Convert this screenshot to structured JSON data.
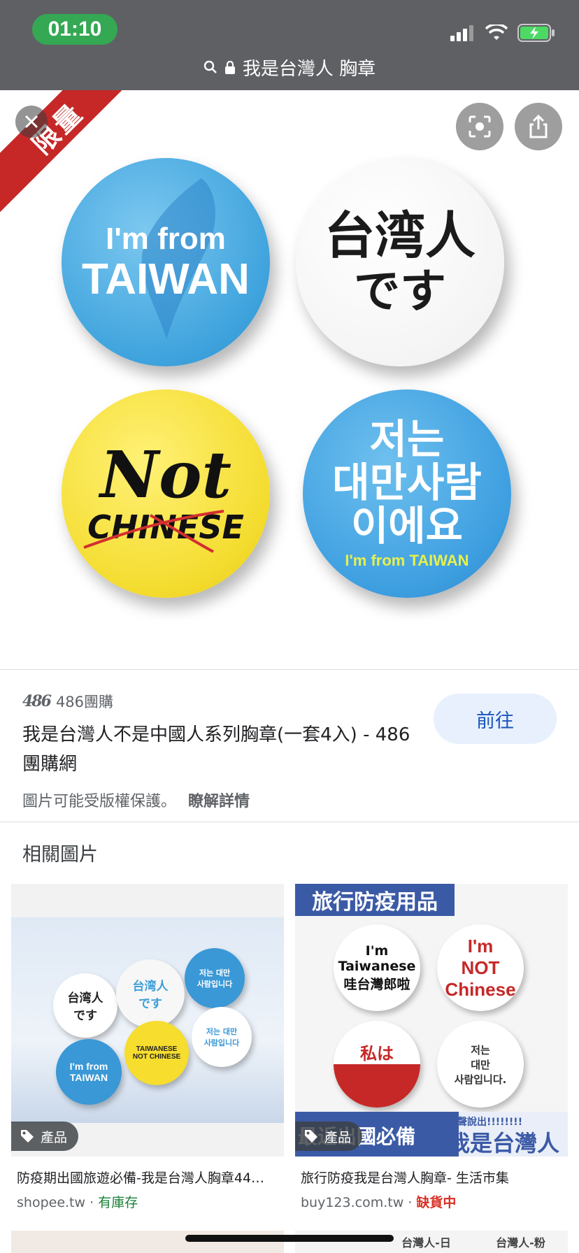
{
  "status": {
    "time": "01:10"
  },
  "urlbar": {
    "query": "我是台灣人 胸章"
  },
  "hero": {
    "ribbon": "限量",
    "badges": [
      {
        "line1": "I'm from",
        "line2": "TAIWAN"
      },
      {
        "line1": "台湾人",
        "line2": "です"
      },
      {
        "line1": "Not",
        "line2": "CHINESE"
      },
      {
        "line1": "저는\n대만사람\n이에요",
        "line2": "I'm from TAIWAN"
      }
    ]
  },
  "result": {
    "source_logo": "486",
    "source_name": "486團購",
    "title": "我是台灣人不是中國人系列胸章(一套4入) - 486團購網",
    "goto_label": "前往",
    "copyright_text": "圖片可能受版權保護。",
    "learn_more": "瞭解詳情"
  },
  "related": {
    "title": "相關圖片",
    "cards": [
      {
        "chip": "產品",
        "caption": "防疫期出國旅遊必備-我是台灣人胸章44…",
        "site": "shopee.tw",
        "stock": "有庫存",
        "stock_color": "#188038",
        "mini_badges": [
          "台湾人\nです",
          "台湾人\nです",
          "저는 대만\n사람입니다",
          "I'm from\nTAIWAN",
          "TAIWANESE\nNOT CHINESE",
          "저는 대만\n사람입니다"
        ]
      },
      {
        "chip": "產品",
        "caption": "旅行防疫我是台灣人胸章- 生活市集",
        "site": "buy123.com.tw",
        "stock": "缺貨中",
        "stock_color": "#d93025",
        "banner_top": "旅行防疫用品",
        "banner_bottom_left": "最近出國必備",
        "banner_bottom_small": "大聲說出!!!!!!!!",
        "banner_bottom_right": "我是台灣人",
        "mini_badges": [
          "I'm\nTaiwanese\n哇台灣郎啦",
          "I'm\nNOT\nChinese",
          "私は\n台灣人です",
          "저는\n대만\n사람입니다."
        ]
      }
    ],
    "next_row": [
      "台灣人-日",
      "台灣人-粉"
    ]
  }
}
